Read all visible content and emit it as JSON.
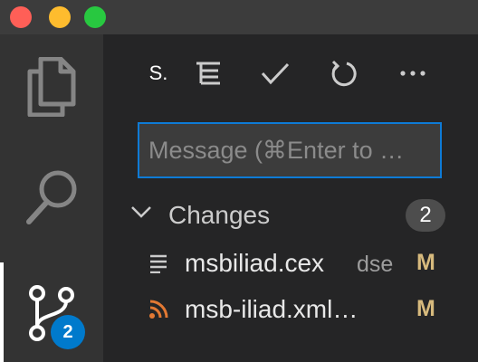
{
  "window": {
    "traffic_lights": {
      "close": "#ff5f57",
      "minimize": "#febc2e",
      "maximize": "#28c840"
    }
  },
  "activity_bar": {
    "items": [
      {
        "name": "explorer",
        "icon": "files-icon"
      },
      {
        "name": "search",
        "icon": "search-icon"
      },
      {
        "name": "source-control",
        "icon": "source-control-icon",
        "badge": "2",
        "active": true
      }
    ]
  },
  "scm_toolbar": {
    "title": "S.",
    "actions": [
      {
        "name": "view-as-tree",
        "icon": "list-tree-icon"
      },
      {
        "name": "commit",
        "icon": "check-icon"
      },
      {
        "name": "refresh",
        "icon": "refresh-icon"
      },
      {
        "name": "more-actions",
        "icon": "ellipsis-icon"
      }
    ]
  },
  "commit_message": {
    "value": "",
    "placeholder": "Message (⌘Enter to …"
  },
  "changes": {
    "label": "Changes",
    "count": "2",
    "files": [
      {
        "name": "msbiliad.cex",
        "dir": "dse",
        "status": "M",
        "icon": "text-file-icon"
      },
      {
        "name": "msb-iliad.xml…",
        "dir": "",
        "status": "M",
        "icon": "rss-icon"
      }
    ]
  },
  "colors": {
    "accent": "#007acc",
    "focus_border": "#0e7bd6",
    "modified": "#d7ba7d",
    "rss": "#e37933"
  }
}
